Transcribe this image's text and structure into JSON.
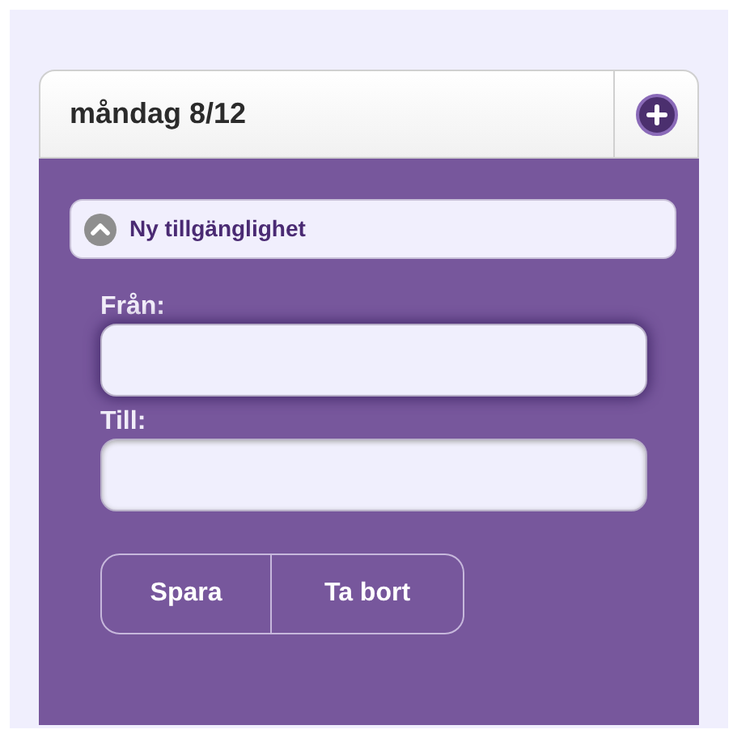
{
  "header": {
    "title": "måndag 8/12"
  },
  "collapsible": {
    "title": "Ny tillgänglighet",
    "expanded": true
  },
  "fields": [
    {
      "label": "Från:",
      "focused": true
    },
    {
      "label": "Till:",
      "focused": false
    }
  ],
  "buttons": [
    "Spara",
    "Ta bort"
  ]
}
